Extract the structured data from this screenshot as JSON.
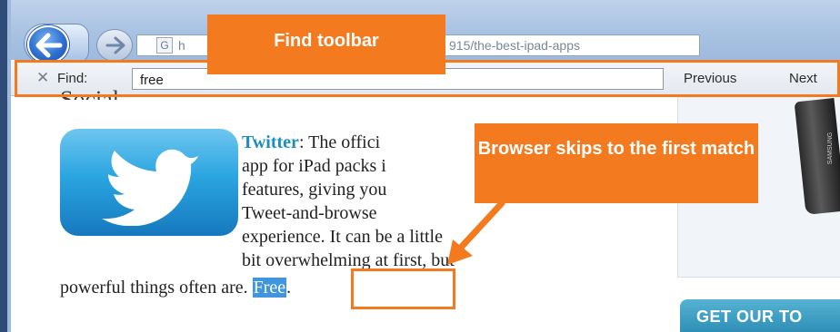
{
  "browser": {
    "url_fragment_left": "h",
    "url_fragment_right": "915/the-best-ipad-apps",
    "page_icon": "G"
  },
  "find_toolbar": {
    "label": "Find:",
    "query": "free",
    "previous_label": "Previous",
    "next_label": "Next"
  },
  "page": {
    "heading": "Social",
    "line1_link": "Twitter",
    "line1_rest": ": The offici",
    "line2": "app for iPad packs i",
    "line3": "features, giving you",
    "line4": "Tweet-and-browse",
    "line5": "experience. It can be a little",
    "line6": "bit overwhelming at first, but",
    "line7": "powerful things often are. ",
    "match_text": "Free",
    "line7_end": ".",
    "cta": "GET OUR TO",
    "device_brand": "SAMSUNG"
  },
  "annotations": {
    "callout_toolbar": "Find toolbar",
    "callout_match": "Browser skips to the first match",
    "accent_color": "#f47a1f"
  }
}
